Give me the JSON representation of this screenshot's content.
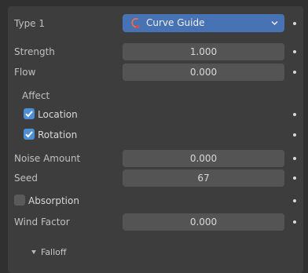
{
  "type_row": {
    "label": "Type 1",
    "value": "Curve Guide",
    "icon": "curve-guide-icon"
  },
  "strength": {
    "label": "Strength",
    "value": "1.000"
  },
  "flow": {
    "label": "Flow",
    "value": "0.000"
  },
  "affect": {
    "label": "Affect",
    "location": {
      "label": "Location",
      "checked": true
    },
    "rotation": {
      "label": "Rotation",
      "checked": true
    }
  },
  "noise_amount": {
    "label": "Noise Amount",
    "value": "0.000"
  },
  "seed": {
    "label": "Seed",
    "value": "67"
  },
  "absorption": {
    "label": "Absorption",
    "checked": false
  },
  "wind_factor": {
    "label": "Wind Factor",
    "value": "0.000"
  },
  "falloff": {
    "label": "Falloff",
    "expanded": false
  },
  "colors": {
    "accent": "#4772b3",
    "checkbox_on": "#4d8fd6",
    "panel": "#3d3d3d",
    "field": "#545454"
  }
}
